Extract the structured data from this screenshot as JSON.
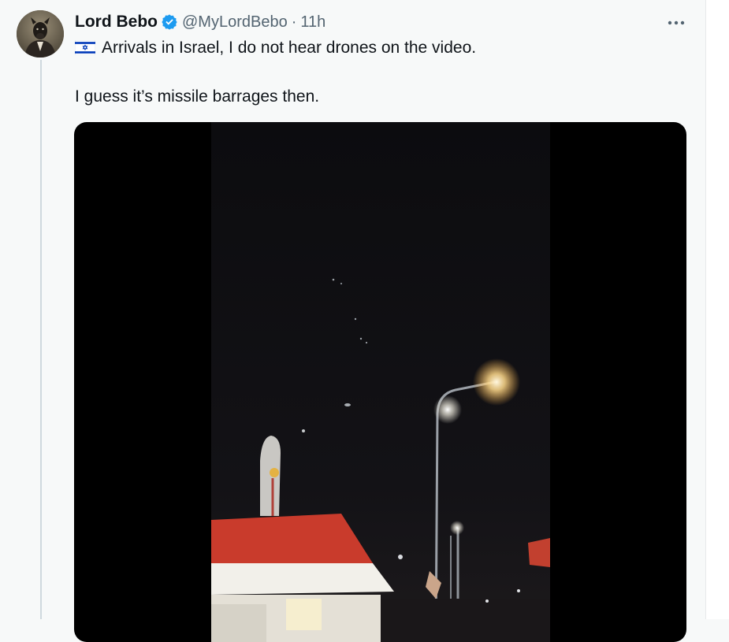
{
  "tweet": {
    "author_name": "Lord Bebo",
    "author_handle": "@MyLordBebo",
    "separator": "·",
    "timestamp": "11h",
    "verified_icon": "verified-badge-icon",
    "more_icon": "more-options-icon",
    "flag_icon": "israel-flag-icon",
    "text_line_1": "Arrivals in Israel, I do not hear drones on the video.",
    "text_line_2": "I guess it’s missile barrages then."
  },
  "colors": {
    "background": "#f7f9f9",
    "text": "#0f1419",
    "secondary_text": "#536471",
    "verified_blue": "#1d9bf0",
    "thread_line": "#cfd9de"
  }
}
